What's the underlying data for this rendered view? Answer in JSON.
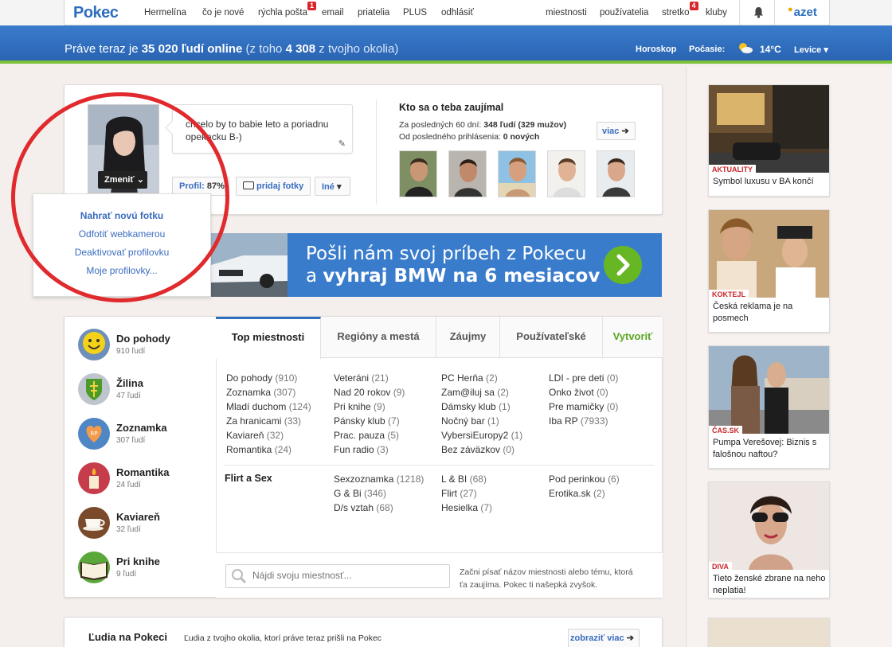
{
  "nav": {
    "logo": "Pokec",
    "items": [
      {
        "label": "Hermelína"
      },
      {
        "label": "čo je nové"
      },
      {
        "label": "rýchla pošta",
        "badge": "1"
      },
      {
        "label": "email"
      },
      {
        "label": "priatelia"
      },
      {
        "label": "PLUS"
      },
      {
        "label": "odhlásiť"
      }
    ],
    "right_items": [
      {
        "label": "miestnosti"
      },
      {
        "label": "používatelia"
      },
      {
        "label": "stretko",
        "badge": "4"
      },
      {
        "label": "kluby"
      }
    ],
    "brand": "azet"
  },
  "header": {
    "online_prefix": "Práve teraz je ",
    "online_count": "35 020 ľudí online",
    "online_mid": " (z toho ",
    "local_count": "4 308",
    "online_suffix": " z tvojho okolia)",
    "horoskop": "Horoskop",
    "pocasie_label": "Počasie:",
    "temperature": "14°C",
    "city": "Levice"
  },
  "profile": {
    "change_button": "Zmeniť",
    "status_text": "chcelo by to babie leto a poriadnu opekacku B-)",
    "profile_label": "Profil:",
    "profile_percent": "87%",
    "add_photos": "pridaj fotky",
    "other": "Iné",
    "dropdown": [
      "Nahrať novú fotku",
      "Odfotiť webkamerou",
      "Deaktivovať profilovku",
      "Moje profilovky..."
    ]
  },
  "interest": {
    "title": "Kto sa o teba zaujímal",
    "line1_prefix": "Za posledných 60 dní: ",
    "line1_value": "348 ľudí (329 mužov)",
    "line2_prefix": "Od posledného prihlásenia: ",
    "line2_value": "0 nových",
    "more": "viac"
  },
  "banner": {
    "line1": "Pošli nám svoj príbeh z Pokecu",
    "line2_prefix": "a ",
    "line2_bold": "vyhraj BMW na 6 mesiacov"
  },
  "rooms_sidebar": [
    {
      "name": "Do pohody",
      "count": "910 ľudí",
      "icon": "smiley-icon"
    },
    {
      "name": "Žilina",
      "count": "47 ľudí",
      "icon": "coat-of-arms-icon"
    },
    {
      "name": "Zoznamka",
      "count": "307 ľudí",
      "icon": "heart-icon"
    },
    {
      "name": "Romantika",
      "count": "24 ľudí",
      "icon": "candle-icon"
    },
    {
      "name": "Kaviareň",
      "count": "32 ľudí",
      "icon": "coffee-cup-icon"
    },
    {
      "name": "Pri knihe",
      "count": "9 ľudí",
      "icon": "book-icon"
    }
  ],
  "tabs": [
    "Top miestnosti",
    "Regióny a mestá",
    "Záujmy",
    "Používateľské",
    "Vytvoriť"
  ],
  "room_columns": [
    [
      [
        "Do pohody",
        "(910)"
      ],
      [
        "Zoznamka",
        "(307)"
      ],
      [
        "Mladí duchom",
        "(124)"
      ],
      [
        "Za hranicami",
        "(33)"
      ],
      [
        "Kaviareň",
        "(32)"
      ],
      [
        "Romantika",
        "(24)"
      ]
    ],
    [
      [
        "Veteráni",
        "(21)"
      ],
      [
        "Nad 20 rokov",
        "(9)"
      ],
      [
        "Pri knihe",
        "(9)"
      ],
      [
        "Pánsky klub",
        "(7)"
      ],
      [
        "Prac. pauza",
        "(5)"
      ],
      [
        "Fun radio",
        "(3)"
      ]
    ],
    [
      [
        "PC Herňa",
        "(2)"
      ],
      [
        "Zam@iluj sa",
        "(2)"
      ],
      [
        "Dámsky klub",
        "(1)"
      ],
      [
        "Nočný bar",
        "(1)"
      ],
      [
        "VybersiEuropy2",
        "(1)"
      ],
      [
        "Bez záväzkov",
        "(0)"
      ]
    ],
    [
      [
        "LDI - pre deti",
        "(0)"
      ],
      [
        "Onko život",
        "(0)"
      ],
      [
        "Pre mamičky",
        "(0)"
      ],
      [
        "Iba RP",
        "(7933)"
      ]
    ]
  ],
  "flirt": {
    "title": "Flirt a Sex",
    "columns": [
      [
        [
          "Sexzoznamka",
          "(1218)"
        ],
        [
          "G & Bi",
          "(346)"
        ],
        [
          "D/s vztah",
          "(68)"
        ]
      ],
      [
        [
          "L & BI",
          "(68)"
        ],
        [
          "Flirt",
          "(27)"
        ],
        [
          "Hesielka",
          "(7)"
        ]
      ],
      [
        [
          "Pod perinkou",
          "(6)"
        ],
        [
          "Erotika.sk",
          "(2)"
        ]
      ]
    ]
  },
  "search": {
    "placeholder": "Nájdi svoju miestnosť...",
    "hint": "Začni písať názov miestnosti alebo tému, ktorá ťa zaujíma. Pokec ti našepká zvyšok."
  },
  "people": {
    "title": "Ľudia na Pokeci",
    "subtitle": "Ľudia z tvojho okolia, ktorí práve teraz prišli na Pokec",
    "more": "zobraziť viac"
  },
  "news": [
    {
      "tag": "AKTUALITY",
      "title": "Symbol luxusu v BA končí"
    },
    {
      "tag": "KOKTEJL",
      "title": "Česká reklama je na posmech"
    },
    {
      "tag": "ČAS.SK",
      "title": "Pumpa Verešovej: Biznis s falošnou naftou?"
    },
    {
      "tag": "DIVA",
      "title": "Tieto ženské zbrane na neho neplatia!"
    }
  ],
  "colors": {
    "brand_blue": "#2f6fc0",
    "accent_green": "#7cc13a",
    "badge_red": "#d9252b",
    "link_blue": "#3a6cbf",
    "highlight_circle": "#e02a2e"
  }
}
